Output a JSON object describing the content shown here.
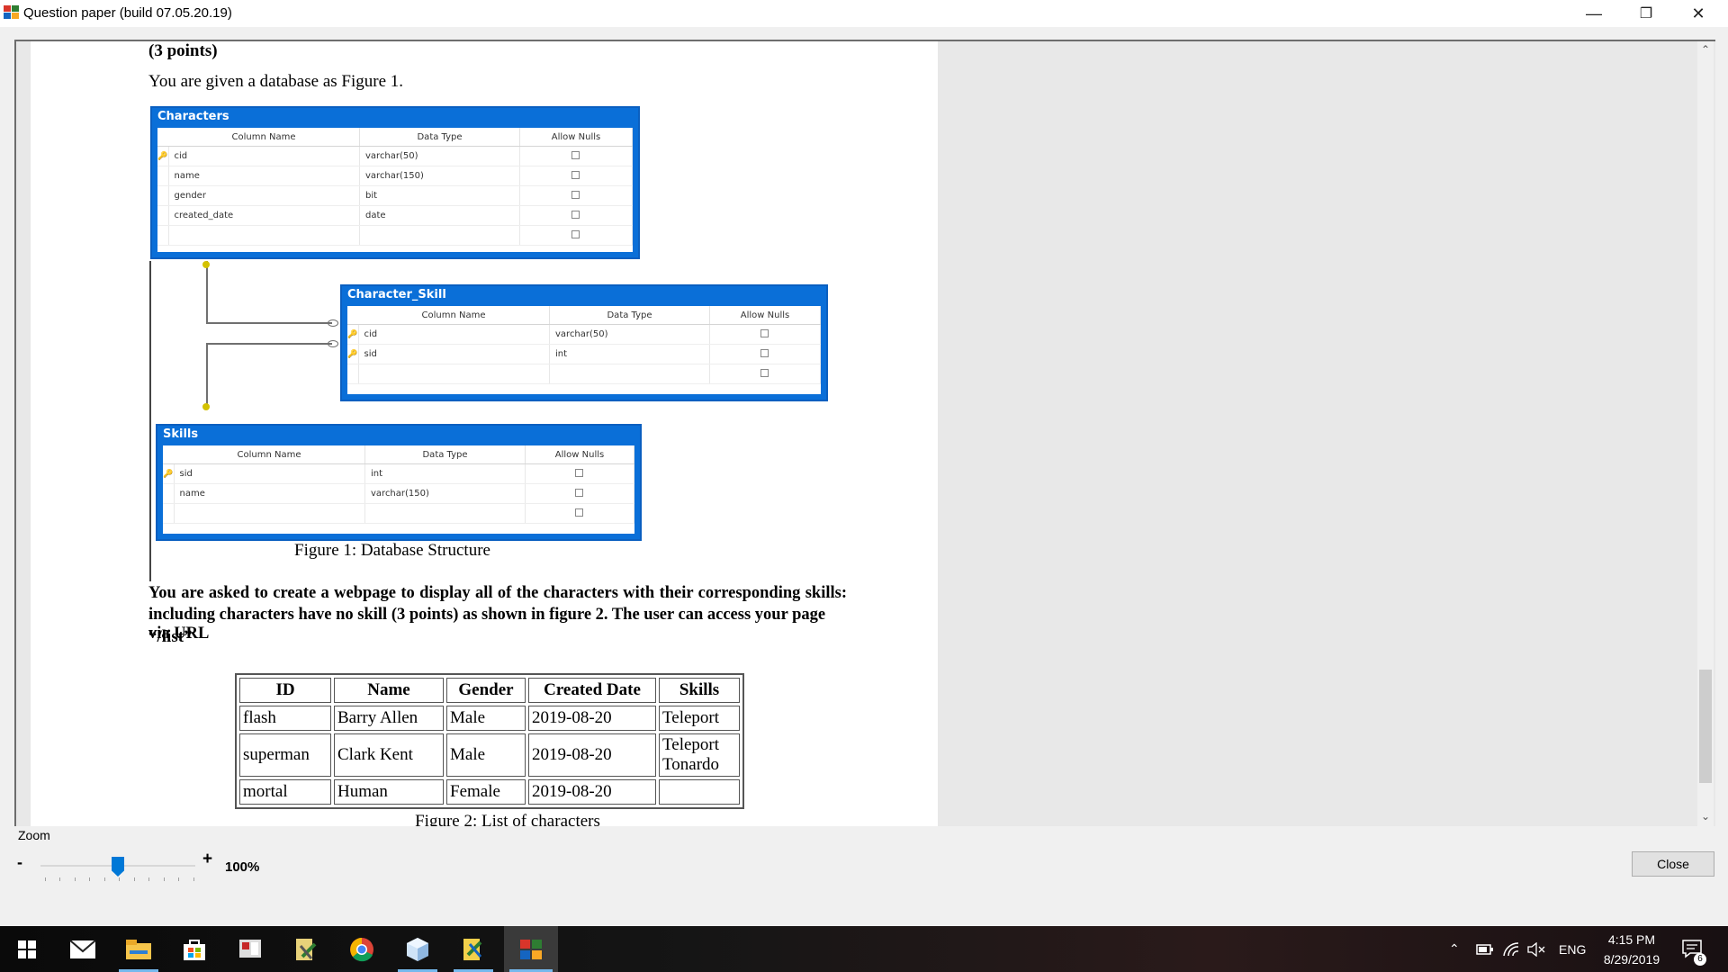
{
  "window": {
    "title": "Question paper (build 07.05.20.19)",
    "minimize": "—",
    "restore": "❐",
    "close": "✕"
  },
  "paper": {
    "points_heading": "(3 points)",
    "intro": "You are given a database as Figure 1.",
    "figure1_caption": "Figure 1: Database Structure",
    "question_line1": "You are asked to create a webpage to display all of the characters with their corresponding skills:",
    "question_line2_a": "including characters have no skill ",
    "question_line2_b": "(3 points)",
    "question_line2_c": " as shown in figure 2. The user can access your page via URL",
    "question_line3": "“/list”",
    "figure2_caption": "Figure 2: List of characters"
  },
  "db": {
    "col_headers": [
      "Column Name",
      "Data Type",
      "Allow Nulls"
    ],
    "characters": {
      "title": "Characters",
      "rows": [
        {
          "key": true,
          "name": "cid",
          "type": "varchar(50)"
        },
        {
          "key": false,
          "name": "name",
          "type": "varchar(150)"
        },
        {
          "key": false,
          "name": "gender",
          "type": "bit"
        },
        {
          "key": false,
          "name": "created_date",
          "type": "date"
        },
        {
          "key": false,
          "name": "",
          "type": ""
        }
      ]
    },
    "character_skill": {
      "title": "Character_Skill",
      "rows": [
        {
          "key": true,
          "name": "cid",
          "type": "varchar(50)"
        },
        {
          "key": true,
          "name": "sid",
          "type": "int"
        },
        {
          "key": false,
          "name": "",
          "type": ""
        }
      ]
    },
    "skills": {
      "title": "Skills",
      "rows": [
        {
          "key": true,
          "name": "sid",
          "type": "int"
        },
        {
          "key": false,
          "name": "name",
          "type": "varchar(150)"
        },
        {
          "key": false,
          "name": "",
          "type": ""
        }
      ]
    }
  },
  "characters_table": {
    "headers": [
      "ID",
      "Name",
      "Gender",
      "Created Date",
      "Skills"
    ],
    "rows": [
      [
        "flash",
        "Barry Allen",
        "Male",
        "2019-08-20",
        "Teleport"
      ],
      [
        "superman",
        "Clark Kent",
        "Male",
        "2019-08-20",
        "Teleport\nTonardo"
      ],
      [
        "mortal",
        "Human",
        "Female",
        "2019-08-20",
        ""
      ]
    ]
  },
  "zoom": {
    "label": "Zoom",
    "minus": "-",
    "plus": "+",
    "value": "100%",
    "level_fraction": 0.5
  },
  "close_button": "Close",
  "taskbar": {
    "apps": [
      "start-icon",
      "mail-icon",
      "file-explorer-icon",
      "store-icon",
      "app-icon",
      "tools-icon",
      "chrome-icon",
      "box-icon",
      "editor-icon",
      "question-paper-icon"
    ],
    "language": "ENG",
    "time": "4:15 PM",
    "date": "8/29/2019",
    "notifications": "6"
  }
}
